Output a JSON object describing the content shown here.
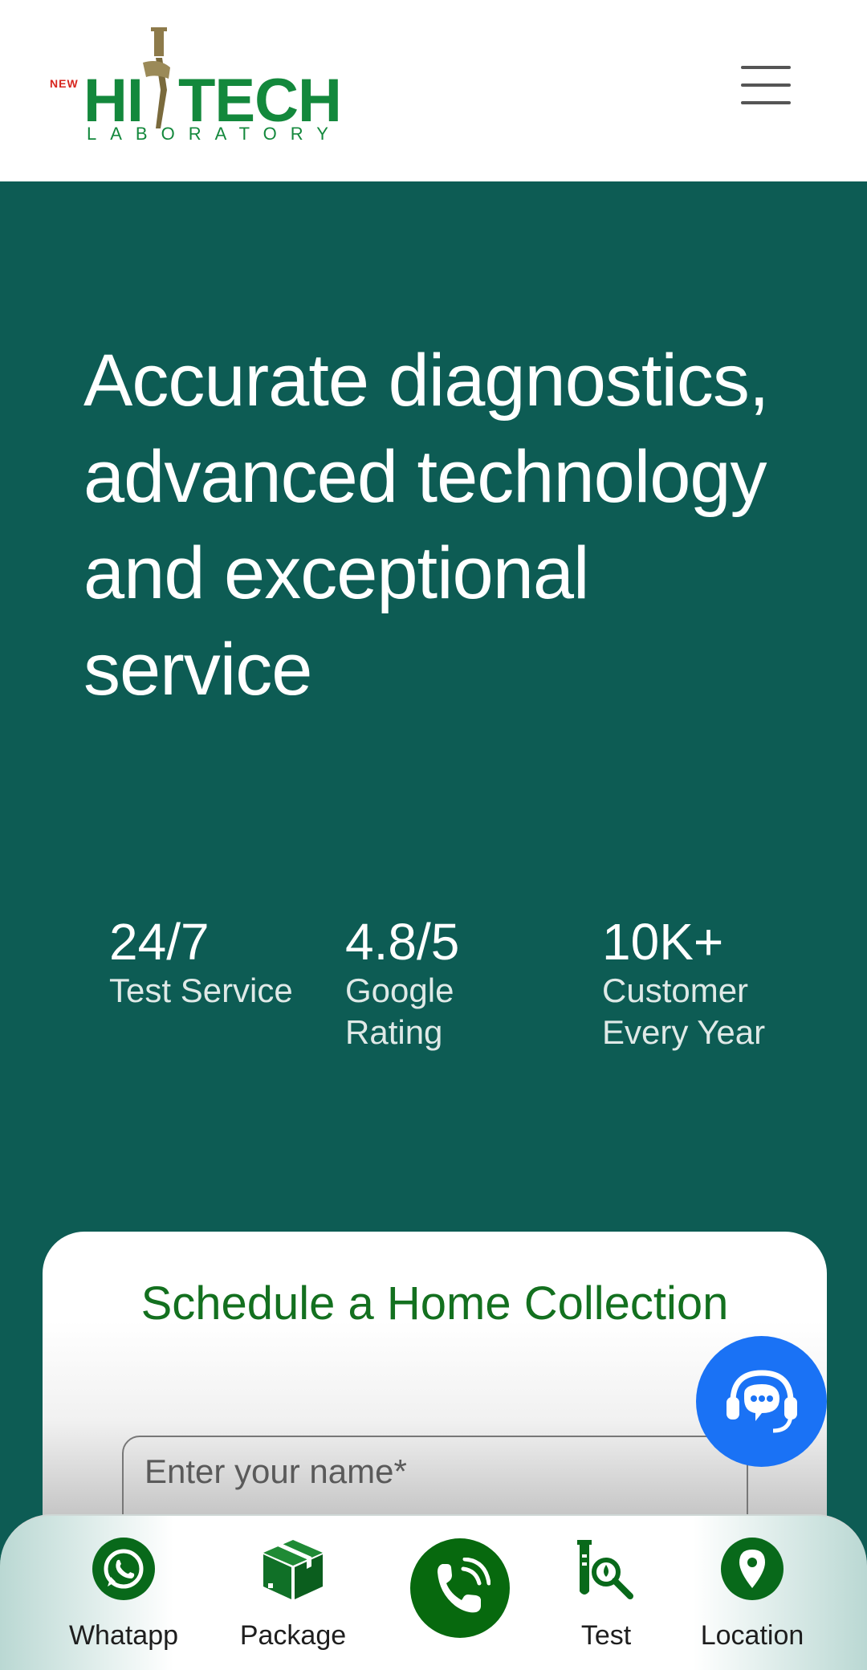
{
  "header": {
    "logo": {
      "prefix": "NEW",
      "part1": "HI",
      "part2": "TECH",
      "subtitle": "LABORATORY"
    },
    "menu_icon": "hamburger-menu-icon"
  },
  "hero": {
    "title": "Accurate diagnostics, advanced technology and exceptional service",
    "stats": [
      {
        "value": "24/7",
        "label": "Test Service"
      },
      {
        "value": "4.8/5",
        "label": "Google Rating"
      },
      {
        "value": "10K+",
        "label": "Customer Every Year"
      }
    ]
  },
  "form": {
    "title": "Schedule a Home Collection",
    "name_placeholder": "Enter your name*"
  },
  "support_fab": {
    "icon": "support-chat-icon",
    "color": "#1a72f5"
  },
  "bottom_nav": {
    "items": [
      {
        "label": "Whatapp",
        "icon": "whatsapp-icon"
      },
      {
        "label": "Package",
        "icon": "package-box-icon"
      },
      {
        "label": "",
        "icon": "phone-call-icon"
      },
      {
        "label": "Test",
        "icon": "test-tube-search-icon"
      },
      {
        "label": "Location",
        "icon": "location-pin-icon"
      }
    ]
  },
  "colors": {
    "primary_teal": "#0d5c54",
    "brand_green": "#13883c",
    "dark_green": "#07690e",
    "support_blue": "#1a72f5"
  }
}
